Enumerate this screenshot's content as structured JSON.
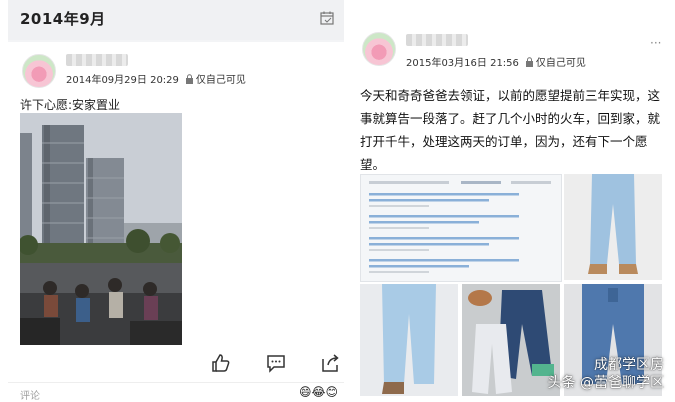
{
  "left_post": {
    "section_title": "2014年9月",
    "timestamp": "2014年09月29日 20:29",
    "visibility": "仅自己可见",
    "text": "许下心愿:安家置业",
    "comment_placeholder": "评论",
    "emoji": "😄😂😊"
  },
  "right_post": {
    "timestamp": "2015年03月16日 21:56",
    "visibility": "仅自己可见",
    "text": "今天和奇奇爸爸去领证，以前的愿望提前三年实现，这事就算告一段落了。赶了几个小时的火车，回到家，就打开千牛，处理这两天的订单，因为，还有下一个愿望。",
    "menu": "···"
  },
  "watermark": {
    "line1": "成都学区房",
    "line2": "头条 @蕾爸聊学区"
  },
  "colors": {
    "background": "#ffffff",
    "left_panel": "#f3f4f6",
    "text": "#222222",
    "muted": "#a0a0a0"
  },
  "icons": {
    "calendar": "calendar-icon",
    "lock": "lock-icon",
    "like": "thumbs-up-icon",
    "comment": "comment-icon",
    "share": "share-icon"
  }
}
